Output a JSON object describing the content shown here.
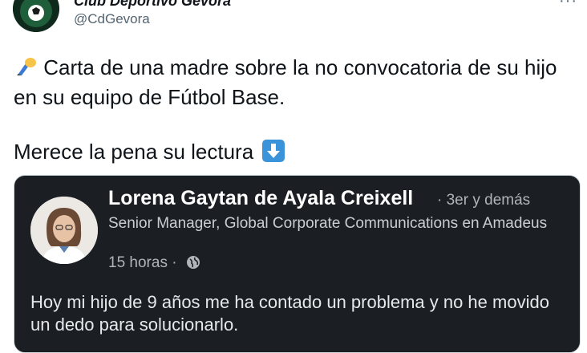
{
  "author": {
    "display_name": "Club Deportivo Gévora",
    "handle": "@CdGevora",
    "avatar_icon": "club-crest-icon"
  },
  "more_icon": "more-icon",
  "tweet": {
    "line1": "Carta de una madre sobre la no convocatoria de su hijo en su equipo de Fútbol Base.",
    "line2": "Merece la pena su lectura",
    "emoji_start": "writing-hand-icon",
    "emoji_end": "down-arrow-icon"
  },
  "card": {
    "name": "Lorena Gaytan de Ayala Creixell",
    "degree": "· 3er y demás",
    "headline": "Senior Manager, Global Corporate Communications en Amadeus",
    "time": "15 horas ·",
    "body": "Hoy mi hijo de 9 años me ha contado un problema y no he movido un dedo para solucionarlo."
  },
  "colors": {
    "card_bg": "#1b1f23",
    "handle": "#536471",
    "emoji_blue": "#3b94d9"
  }
}
